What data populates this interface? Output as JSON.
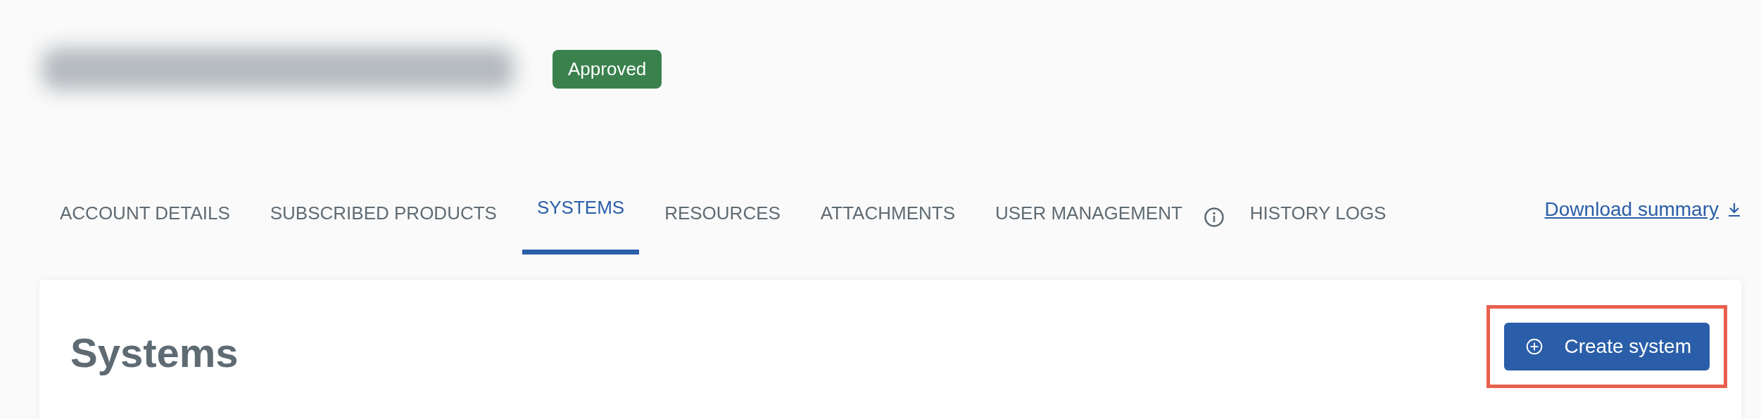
{
  "header": {
    "status_badge": "Approved"
  },
  "tabs": [
    {
      "label": "ACCOUNT DETAILS",
      "selected": false
    },
    {
      "label": "SUBSCRIBED PRODUCTS",
      "selected": false
    },
    {
      "label": "SYSTEMS",
      "selected": true
    },
    {
      "label": "RESOURCES",
      "selected": false
    },
    {
      "label": "ATTACHMENTS",
      "selected": false
    },
    {
      "label": "USER MANAGEMENT",
      "selected": false,
      "info": true
    },
    {
      "label": "HISTORY LOGS",
      "selected": false
    }
  ],
  "download_link": "Download summary",
  "card": {
    "title": "Systems",
    "create_button": "Create system",
    "highlighted": true
  }
}
